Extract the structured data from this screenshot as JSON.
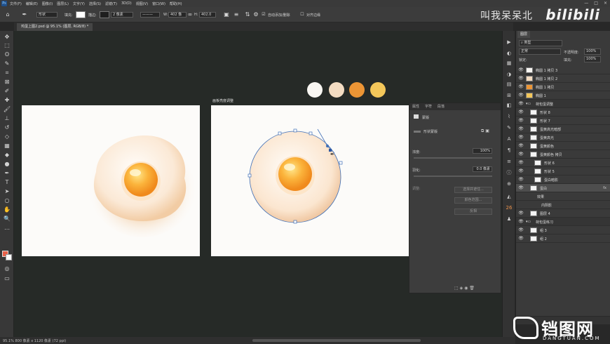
{
  "menubar": {
    "items": [
      "文件(F)",
      "编辑(E)",
      "图像(I)",
      "图层(L)",
      "文字(Y)",
      "选择(S)",
      "滤镜(T)",
      "3D(D)",
      "视图(V)",
      "窗口(W)",
      "帮助(H)"
    ],
    "window_controls": [
      "—",
      "□",
      "×"
    ]
  },
  "options": {
    "tool_mode": "形状",
    "fill_label": "填充:",
    "stroke_label": "描边:",
    "stroke_width": "2 像素",
    "w_label": "W:",
    "w_value": "402 像",
    "h_label": "H:",
    "h_value": "402.0",
    "auto_add_delete": "自动添加/删除",
    "align_edges": "对齐边缘"
  },
  "watermark": {
    "author": "叫我呆呆北",
    "bilibili": "bilibili"
  },
  "document_tab": {
    "title": "鸡蛋上图2.psd @ 95.1% (图层, RGB/8) *"
  },
  "canvas": {
    "artboard2_label": "画板亮度调整",
    "palette": [
      "#f8f6f2",
      "#f3dcc2",
      "#ec9535",
      "#f4c75a"
    ]
  },
  "status": {
    "text": "95.1%  800 像素 x 1120 像素 (72 ppi)"
  },
  "properties_panel": {
    "tabs": [
      "属性",
      "字符",
      "段落"
    ],
    "type_label": "蒙版",
    "shape_mask": "形状蒙版",
    "density_label": "浓度:",
    "density_value": "100%",
    "feather_label": "羽化:",
    "feather_value": "0.0 像素",
    "adjust_label": "调整:",
    "buttons": [
      "选择并遮住...",
      "颜色范围...",
      "反相"
    ]
  },
  "layers_panel": {
    "tab": "图层",
    "kind_filter": "类型",
    "blend_mode": "正常",
    "opacity_label": "不透明度:",
    "opacity_value": "100%",
    "lock_label": "锁定:",
    "fill_label": "填充:",
    "fill_value": "100%",
    "layers": [
      {
        "name": "椭圆 1 拷贝 3",
        "indent": 0,
        "group": false,
        "thumb": "#f8f6f2"
      },
      {
        "name": "椭圆 1 拷贝 2",
        "indent": 0,
        "group": false,
        "thumb": "#f3dcc2"
      },
      {
        "name": "椭圆 1 拷贝",
        "indent": 0,
        "group": false,
        "thumb": "#ec9535"
      },
      {
        "name": "椭圆 1",
        "indent": 0,
        "group": false,
        "thumb": "#f4c75a"
      },
      {
        "name": "荷包蛋调整",
        "indent": 0,
        "group": true
      },
      {
        "name": "形状 8",
        "indent": 1,
        "group": false,
        "thumb": "#f4f4f4"
      },
      {
        "name": "形状 7",
        "indent": 1,
        "group": false,
        "thumb": "#f4f4f4"
      },
      {
        "name": "蛋黄高光暗部",
        "indent": 1,
        "group": false,
        "thumb": "#f4f4f4"
      },
      {
        "name": "蛋黄高光",
        "indent": 1,
        "group": false,
        "thumb": "#f4f4f4"
      },
      {
        "name": "蛋黄颜色",
        "indent": 1,
        "group": false,
        "thumb": "#f4f4f4"
      },
      {
        "name": "蛋黄颜色 拷贝",
        "indent": 1,
        "group": false,
        "thumb": "#f4f4f4"
      },
      {
        "name": "形状 6",
        "indent": 2,
        "group": false,
        "thumb": "#f4f4f4"
      },
      {
        "name": "形状 5",
        "indent": 2,
        "group": false,
        "thumb": "#f4f4f4"
      },
      {
        "name": "蛋白暗影",
        "indent": 2,
        "group": false,
        "thumb": "#f4f4f4"
      },
      {
        "name": "蛋白",
        "indent": 1,
        "group": false,
        "thumb": "#f4f4f4",
        "selected": true,
        "fx": "fx"
      },
      {
        "name": "效果",
        "indent": 2,
        "group": false,
        "effect": true
      },
      {
        "name": "内阴影",
        "indent": 3,
        "group": false,
        "effect": true
      },
      {
        "name": "图层 4",
        "indent": 1,
        "group": false,
        "thumb": "#f4f4f4"
      },
      {
        "name": "荷包蛋练习",
        "indent": 0,
        "group": true
      },
      {
        "name": "组 3",
        "indent": 1,
        "group": false,
        "thumb": "#f4f4f4"
      },
      {
        "name": "组 2",
        "indent": 1,
        "group": false,
        "thumb": "#f4f4f4"
      }
    ]
  },
  "brand": {
    "main": "铛图网",
    "sub": "DANGTUAN.COM"
  },
  "colors": {
    "accent_fg": "#e8614a",
    "canvas_bg": "#262a27"
  }
}
